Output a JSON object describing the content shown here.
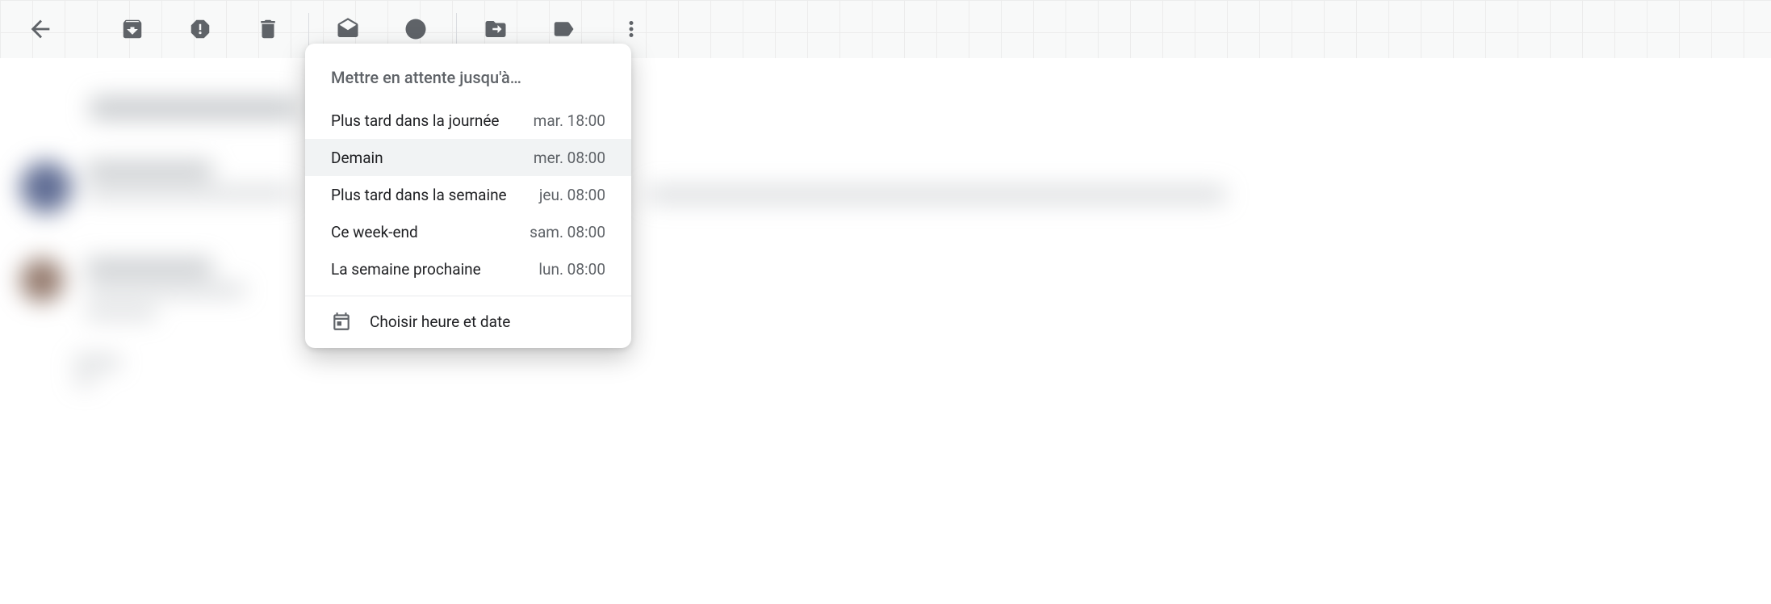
{
  "toolbar": {
    "back": "back",
    "archive": "archive",
    "spam": "report-spam",
    "delete": "delete",
    "mark_unread": "mark-unread",
    "snooze": "snooze",
    "move": "move-to",
    "label": "labels",
    "more": "more"
  },
  "snooze_menu": {
    "title": "Mettre en attente jusqu'à…",
    "options": [
      {
        "label": "Plus tard dans la journée",
        "time": "mar. 18:00",
        "hovered": false
      },
      {
        "label": "Demain",
        "time": "mer. 08:00",
        "hovered": true
      },
      {
        "label": "Plus tard dans la semaine",
        "time": "jeu. 08:00",
        "hovered": false
      },
      {
        "label": "Ce week-end",
        "time": "sam. 08:00",
        "hovered": false
      },
      {
        "label": "La semaine prochaine",
        "time": "lun. 08:00",
        "hovered": false
      }
    ],
    "pick_label": "Choisir heure et date"
  }
}
